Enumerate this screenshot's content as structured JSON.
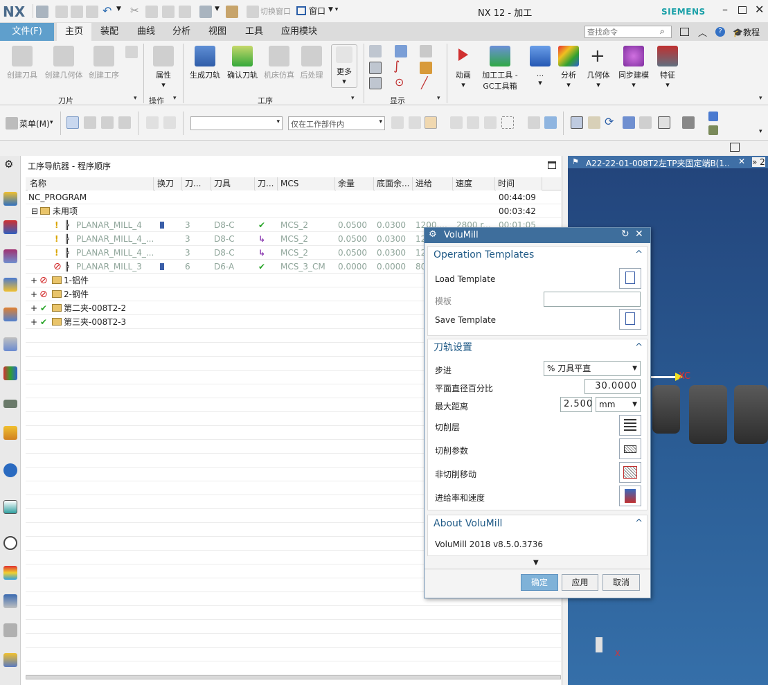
{
  "titlebar": {
    "logo": "NX",
    "switch_window": "切换窗口",
    "window_menu": "窗口",
    "title": "NX 12 - 加工",
    "brand": "SIEMENS"
  },
  "menubar": {
    "file": "文件(F)",
    "items": [
      "主页",
      "装配",
      "曲线",
      "分析",
      "视图",
      "工具",
      "应用模块"
    ],
    "search_placeholder": "查找命令",
    "help": "教程"
  },
  "ribbon": {
    "buttons": [
      "创建刀具",
      "创建几何体",
      "创建工序",
      "属性",
      "生成刀轨",
      "确认刀轨",
      "机床仿真",
      "后处理",
      "更多",
      "动画",
      "加工工具 -",
      "GC工具箱",
      "...",
      "分析",
      "几何体",
      "同步建模",
      "特征"
    ],
    "groups": [
      "刀片",
      "操作",
      "工序",
      "显示"
    ]
  },
  "toolbar2": {
    "menu": "菜单(M)",
    "filter_placeholder": "",
    "scope": "仅在工作部件内"
  },
  "navigator": {
    "title": "工序导航器 - 程序顺序",
    "columns": [
      "名称",
      "换刀",
      "刀...",
      "刀具",
      "刀...",
      "MCS",
      "余量",
      "底面余...",
      "进给",
      "速度",
      "时间"
    ],
    "rows": [
      {
        "name": "NC_PROGRAM",
        "time": "00:44:09"
      },
      {
        "name": "未用项",
        "time": "00:03:42"
      },
      {
        "name": "PLANAR_MILL_4",
        "tool_no": "3",
        "tool": "D8-C",
        "mcs": "MCS_2",
        "stock": "0.0500",
        "floor": "0.0300",
        "feed": "1200....",
        "speed": "2800 r...",
        "time": "00:01:05"
      },
      {
        "name": "PLANAR_MILL_4_...",
        "tool_no": "3",
        "tool": "D8-C",
        "mcs": "MCS_2",
        "stock": "0.0500",
        "floor": "0.0300",
        "feed": "12"
      },
      {
        "name": "PLANAR_MILL_4_...",
        "tool_no": "3",
        "tool": "D8-C",
        "mcs": "MCS_2",
        "stock": "0.0500",
        "floor": "0.0300",
        "feed": "12"
      },
      {
        "name": "PLANAR_MILL_3",
        "tool_no": "6",
        "tool": "D6-A",
        "mcs": "MCS_3_CM",
        "stock": "0.0000",
        "floor": "0.0000",
        "feed": "80"
      },
      {
        "name": "1-铝件"
      },
      {
        "name": "2-钢件"
      },
      {
        "name": "第二夹-008T2-2"
      },
      {
        "name": "第三夹-008T2-3"
      }
    ]
  },
  "viewport": {
    "tab": "A22-22-01-008T2左TP夹固定端B(1...",
    "overflow": "» 2",
    "axis_xc": "XC",
    "axis_x": "X"
  },
  "dialog": {
    "title": "VoluMill",
    "sec1": {
      "title": "Operation Templates",
      "load": "Load Template",
      "template": "模板",
      "save": "Save Template"
    },
    "sec2": {
      "title": "刀轨设置",
      "step": "步进",
      "step_value": "% 刀具平直",
      "flat_pct": "平面直径百分比",
      "flat_value": "30.0000",
      "max_dist": "最大距离",
      "max_value": "2.500",
      "unit": "mm",
      "cut_levels": "切削层",
      "cut_params": "切削参数",
      "noncut": "非切削移动",
      "feeds": "进给率和速度"
    },
    "sec3": {
      "title": "About VoluMill",
      "version": "VoluMill 2018 v8.5.0.3736"
    },
    "ok": "确定",
    "apply": "应用",
    "cancel": "取消"
  },
  "colors": {
    "file_tab": "#5f9fcc",
    "accent": "#215b87",
    "check": "#2aa52a",
    "warn": "#d9a400",
    "stop": "#d02020",
    "viewport": "#2b5d95"
  }
}
